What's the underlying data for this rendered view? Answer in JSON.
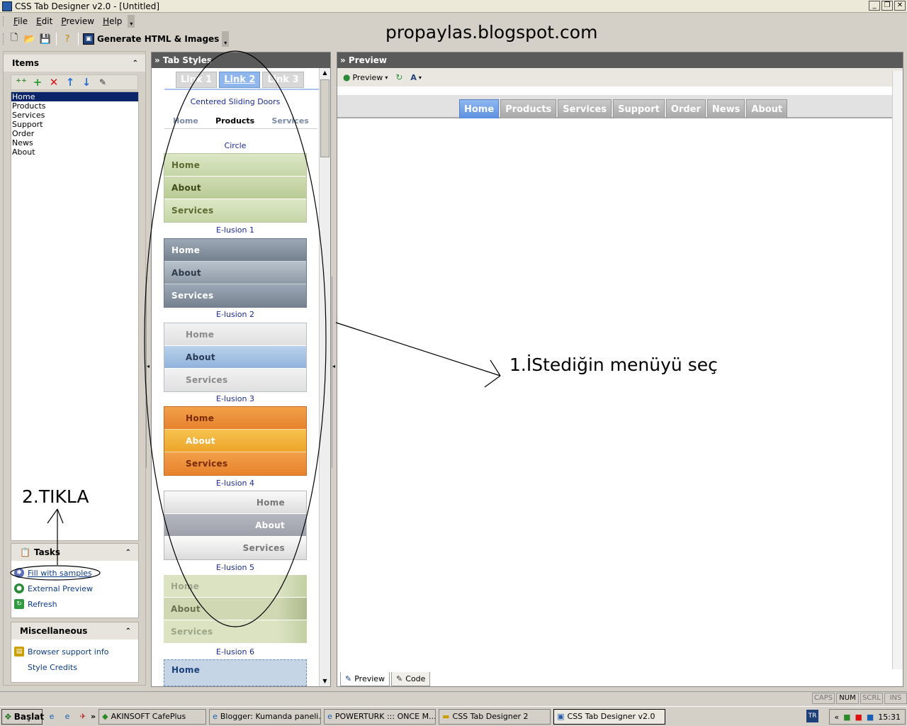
{
  "window": {
    "title": "CSS Tab Designer v2.0 - [Untitled]"
  },
  "menu": [
    "File",
    "Edit",
    "Preview",
    "Help"
  ],
  "toolbar": {
    "generate_label": "Generate HTML & Images"
  },
  "watermark": "propaylas.blogspot.com",
  "items_panel": {
    "title": "Items",
    "items": [
      "Home",
      "Products",
      "Services",
      "Support",
      "Order",
      "News",
      "About"
    ],
    "selected": "Home"
  },
  "tasks_panel": {
    "title": "Tasks",
    "links": [
      "Fill with samples",
      "External Preview",
      "Refresh"
    ]
  },
  "misc_panel": {
    "title": "Miscellaneous",
    "links": [
      "Browser support info",
      "Style Credits"
    ]
  },
  "tab_styles": {
    "title": "» Tab Styles",
    "sliding_tabs": [
      "Link 1",
      "Link 2",
      "Link 3"
    ],
    "captions": [
      "Centered Sliding Doors",
      "Circle",
      "E-lusion 1",
      "E-lusion 2",
      "E-lusion 3",
      "E-lusion 4",
      "E-lusion 5",
      "E-lusion 6"
    ],
    "circle_tabs": [
      "Home",
      "Products",
      "Services"
    ],
    "list_labels": {
      "home": "Home",
      "about": "About",
      "services": "Services"
    }
  },
  "preview": {
    "title": "» Preview",
    "toolbar_label": "Preview",
    "tabs": [
      "Home",
      "Products",
      "Services",
      "Support",
      "Order",
      "News",
      "About"
    ],
    "active_tab": "Home",
    "bottom_tabs": [
      "Preview",
      "Code"
    ]
  },
  "annotations": {
    "select": "1.İStediğin menüyü seç",
    "click": "2.TIKLA"
  },
  "status": {
    "indicators": [
      "CAPS",
      "NUM",
      "SCRL",
      "INS"
    ]
  },
  "taskbar": {
    "start": "Başlat",
    "tasks": [
      "AKINSOFT CafePlus",
      "Blogger: Kumanda paneli...",
      "POWERTURK ::: ONCE M...",
      "CSS Tab Designer 2",
      "CSS Tab Designer v2.0"
    ],
    "lang": "TR",
    "clock": "15:31"
  }
}
